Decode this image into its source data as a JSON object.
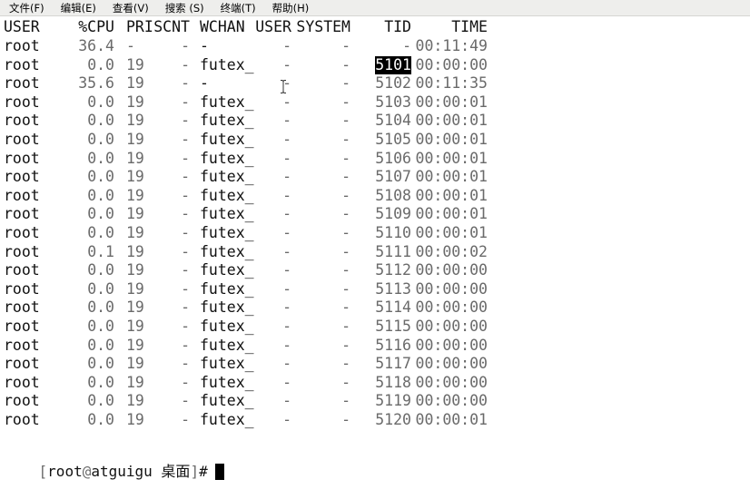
{
  "menu": [
    "文件(F)",
    "编辑(E)",
    "查看(V)",
    "搜索 (S)",
    "终端(T)",
    "帮助(H)"
  ],
  "headers": {
    "user": "USER",
    "cpu": "%CPU",
    "pri": "PRI",
    "scnt": "SCNT",
    "wchan": "WCHAN",
    "suser": "USER",
    "system": "SYSTEM",
    "tid": "TID",
    "time": "TIME"
  },
  "rows": [
    {
      "user": "root",
      "cpu": "36.4",
      "pri": "-",
      "scnt": "-",
      "wchan": "-",
      "suser": "-",
      "system": "-",
      "tid": "-",
      "time": "00:11:49"
    },
    {
      "user": "root",
      "cpu": "0.0",
      "pri": "19",
      "scnt": "-",
      "wchan": "futex_",
      "suser": "-",
      "system": "-",
      "tid": "5101",
      "time": "00:00:00",
      "selected": true
    },
    {
      "user": "root",
      "cpu": "35.6",
      "pri": "19",
      "scnt": "-",
      "wchan": "-",
      "suser": "-",
      "system": "-",
      "tid": "5102",
      "time": "00:11:35"
    },
    {
      "user": "root",
      "cpu": "0.0",
      "pri": "19",
      "scnt": "-",
      "wchan": "futex_",
      "suser": "-",
      "system": "-",
      "tid": "5103",
      "time": "00:00:01"
    },
    {
      "user": "root",
      "cpu": "0.0",
      "pri": "19",
      "scnt": "-",
      "wchan": "futex_",
      "suser": "-",
      "system": "-",
      "tid": "5104",
      "time": "00:00:01"
    },
    {
      "user": "root",
      "cpu": "0.0",
      "pri": "19",
      "scnt": "-",
      "wchan": "futex_",
      "suser": "-",
      "system": "-",
      "tid": "5105",
      "time": "00:00:01"
    },
    {
      "user": "root",
      "cpu": "0.0",
      "pri": "19",
      "scnt": "-",
      "wchan": "futex_",
      "suser": "-",
      "system": "-",
      "tid": "5106",
      "time": "00:00:01"
    },
    {
      "user": "root",
      "cpu": "0.0",
      "pri": "19",
      "scnt": "-",
      "wchan": "futex_",
      "suser": "-",
      "system": "-",
      "tid": "5107",
      "time": "00:00:01"
    },
    {
      "user": "root",
      "cpu": "0.0",
      "pri": "19",
      "scnt": "-",
      "wchan": "futex_",
      "suser": "-",
      "system": "-",
      "tid": "5108",
      "time": "00:00:01"
    },
    {
      "user": "root",
      "cpu": "0.0",
      "pri": "19",
      "scnt": "-",
      "wchan": "futex_",
      "suser": "-",
      "system": "-",
      "tid": "5109",
      "time": "00:00:01"
    },
    {
      "user": "root",
      "cpu": "0.0",
      "pri": "19",
      "scnt": "-",
      "wchan": "futex_",
      "suser": "-",
      "system": "-",
      "tid": "5110",
      "time": "00:00:01"
    },
    {
      "user": "root",
      "cpu": "0.1",
      "pri": "19",
      "scnt": "-",
      "wchan": "futex_",
      "suser": "-",
      "system": "-",
      "tid": "5111",
      "time": "00:00:02"
    },
    {
      "user": "root",
      "cpu": "0.0",
      "pri": "19",
      "scnt": "-",
      "wchan": "futex_",
      "suser": "-",
      "system": "-",
      "tid": "5112",
      "time": "00:00:00"
    },
    {
      "user": "root",
      "cpu": "0.0",
      "pri": "19",
      "scnt": "-",
      "wchan": "futex_",
      "suser": "-",
      "system": "-",
      "tid": "5113",
      "time": "00:00:00"
    },
    {
      "user": "root",
      "cpu": "0.0",
      "pri": "19",
      "scnt": "-",
      "wchan": "futex_",
      "suser": "-",
      "system": "-",
      "tid": "5114",
      "time": "00:00:00"
    },
    {
      "user": "root",
      "cpu": "0.0",
      "pri": "19",
      "scnt": "-",
      "wchan": "futex_",
      "suser": "-",
      "system": "-",
      "tid": "5115",
      "time": "00:00:00"
    },
    {
      "user": "root",
      "cpu": "0.0",
      "pri": "19",
      "scnt": "-",
      "wchan": "futex_",
      "suser": "-",
      "system": "-",
      "tid": "5116",
      "time": "00:00:00"
    },
    {
      "user": "root",
      "cpu": "0.0",
      "pri": "19",
      "scnt": "-",
      "wchan": "futex_",
      "suser": "-",
      "system": "-",
      "tid": "5117",
      "time": "00:00:00"
    },
    {
      "user": "root",
      "cpu": "0.0",
      "pri": "19",
      "scnt": "-",
      "wchan": "futex_",
      "suser": "-",
      "system": "-",
      "tid": "5118",
      "time": "00:00:00"
    },
    {
      "user": "root",
      "cpu": "0.0",
      "pri": "19",
      "scnt": "-",
      "wchan": "futex_",
      "suser": "-",
      "system": "-",
      "tid": "5119",
      "time": "00:00:00"
    },
    {
      "user": "root",
      "cpu": "0.0",
      "pri": "19",
      "scnt": "-",
      "wchan": "futex_",
      "suser": "-",
      "system": "-",
      "tid": "5120",
      "time": "00:00:01"
    }
  ],
  "prompt": {
    "open": "[",
    "user": "root",
    "at": "@",
    "host": "atguigu",
    "dir": "桌面",
    "close": "]",
    "symbol": "#"
  },
  "icons": {
    "mouse_pointer": "ibeam-cursor-icon",
    "text_cursor": "block-cursor-icon"
  }
}
